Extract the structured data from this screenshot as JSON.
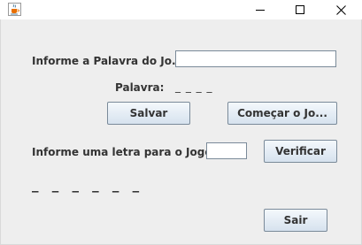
{
  "window": {
    "title": "",
    "controls": {
      "minimize": "minimize",
      "maximize": "maximize",
      "close": "close"
    }
  },
  "form": {
    "word_prompt_label": "Informe a Palavra do Jo...",
    "word_input_value": "",
    "word_label": "Palavra:",
    "word_mask": "_ _ _ _",
    "save_button": "Salvar",
    "start_button": "Começar o Jo...",
    "letter_prompt_label": "Informe uma letra para o Jogo:",
    "letter_input_value": "",
    "verify_button": "Verificar",
    "progress_blanks": "_ _ _ _ _ _",
    "exit_button": "Sair"
  },
  "colors": {
    "background": "#eeeeee",
    "button_border": "#7a8a99",
    "titlebar": "#ffffff"
  }
}
